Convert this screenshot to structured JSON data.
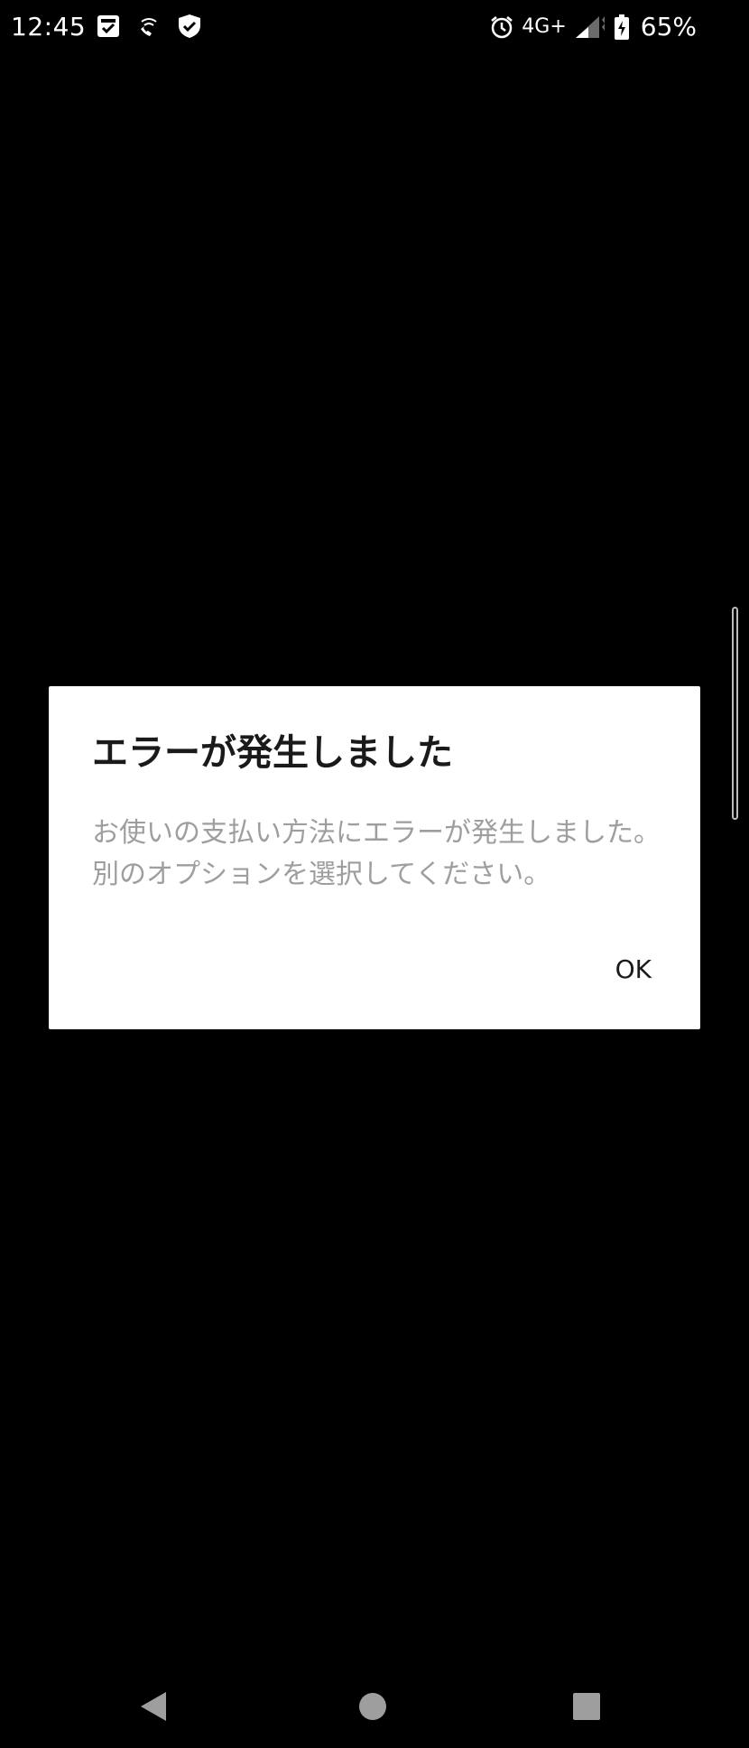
{
  "status_bar": {
    "time": "12:45",
    "left_icons": [
      "clipboard-check-icon",
      "wifi-calling-icon",
      "shield-check-icon"
    ],
    "network": "4G+",
    "battery_percent": "65%",
    "right_icons": [
      "alarm-icon",
      "signal-icon",
      "battery-charging-icon"
    ]
  },
  "dialog": {
    "title": "エラーが発生しました",
    "message": "お使いの支払い方法にエラーが発生しました。 別のオプションを選択してください。",
    "ok_label": "OK"
  },
  "nav_bar": {
    "buttons": [
      "back-icon",
      "home-icon",
      "recents-icon"
    ]
  },
  "colors": {
    "background": "#000000",
    "dialog_bg": "#ffffff",
    "title_text": "#1a1a1a",
    "message_text": "#9e9e9e",
    "nav_icon": "#9e9e9e"
  }
}
